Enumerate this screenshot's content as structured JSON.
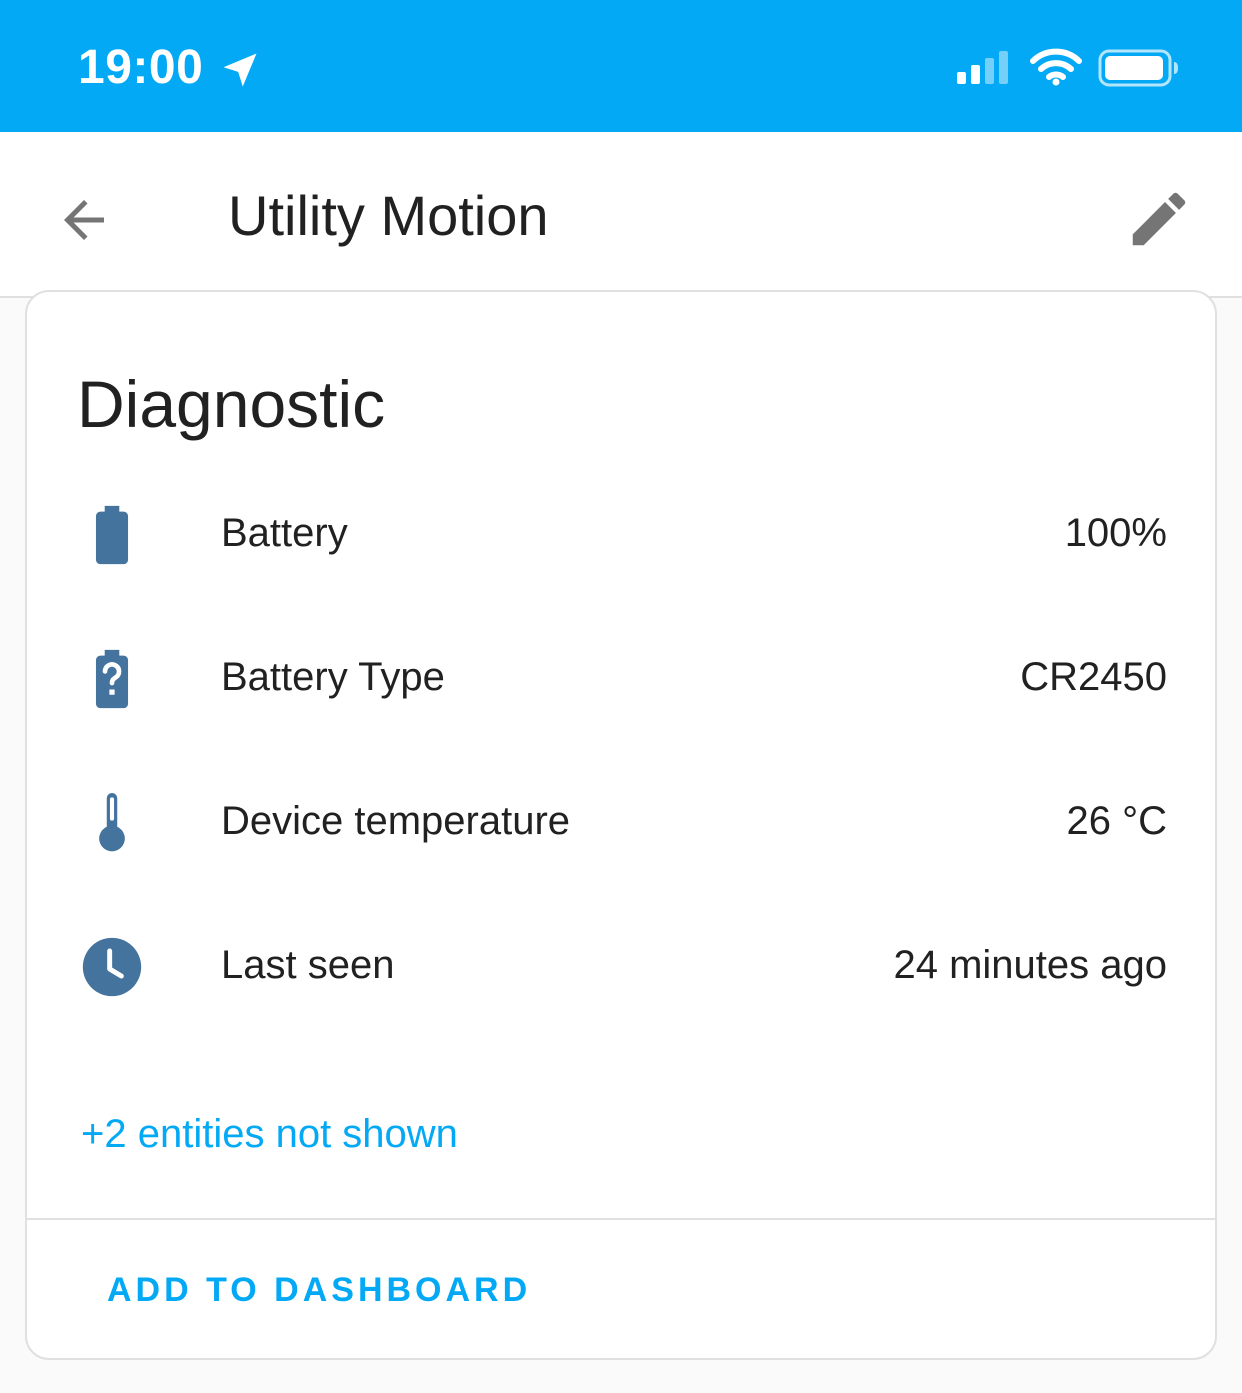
{
  "status_bar": {
    "time": "19:00",
    "icons": [
      "location-arrow-icon",
      "cellular-signal-icon",
      "wifi-icon",
      "battery-icon"
    ]
  },
  "app_bar": {
    "title": "Utility Motion",
    "back_icon": "arrow-left-icon",
    "edit_icon": "pencil-icon"
  },
  "card": {
    "title": "Diagnostic",
    "rows": [
      {
        "icon": "battery-icon",
        "name": "Battery",
        "value": "100%"
      },
      {
        "icon": "battery-unknown-icon",
        "name": "Battery Type",
        "value": "CR2450"
      },
      {
        "icon": "thermometer-icon",
        "name": "Device temperature",
        "value": "26 °C"
      },
      {
        "icon": "clock-icon",
        "name": "Last seen",
        "value": "24 minutes ago"
      }
    ],
    "more_link": "+2 entities not shown",
    "action_label": "ADD TO DASHBOARD"
  },
  "colors": {
    "accent": "#03a9f4",
    "icon": "#44739e",
    "text": "#212121",
    "divider": "#e0e0e0"
  }
}
